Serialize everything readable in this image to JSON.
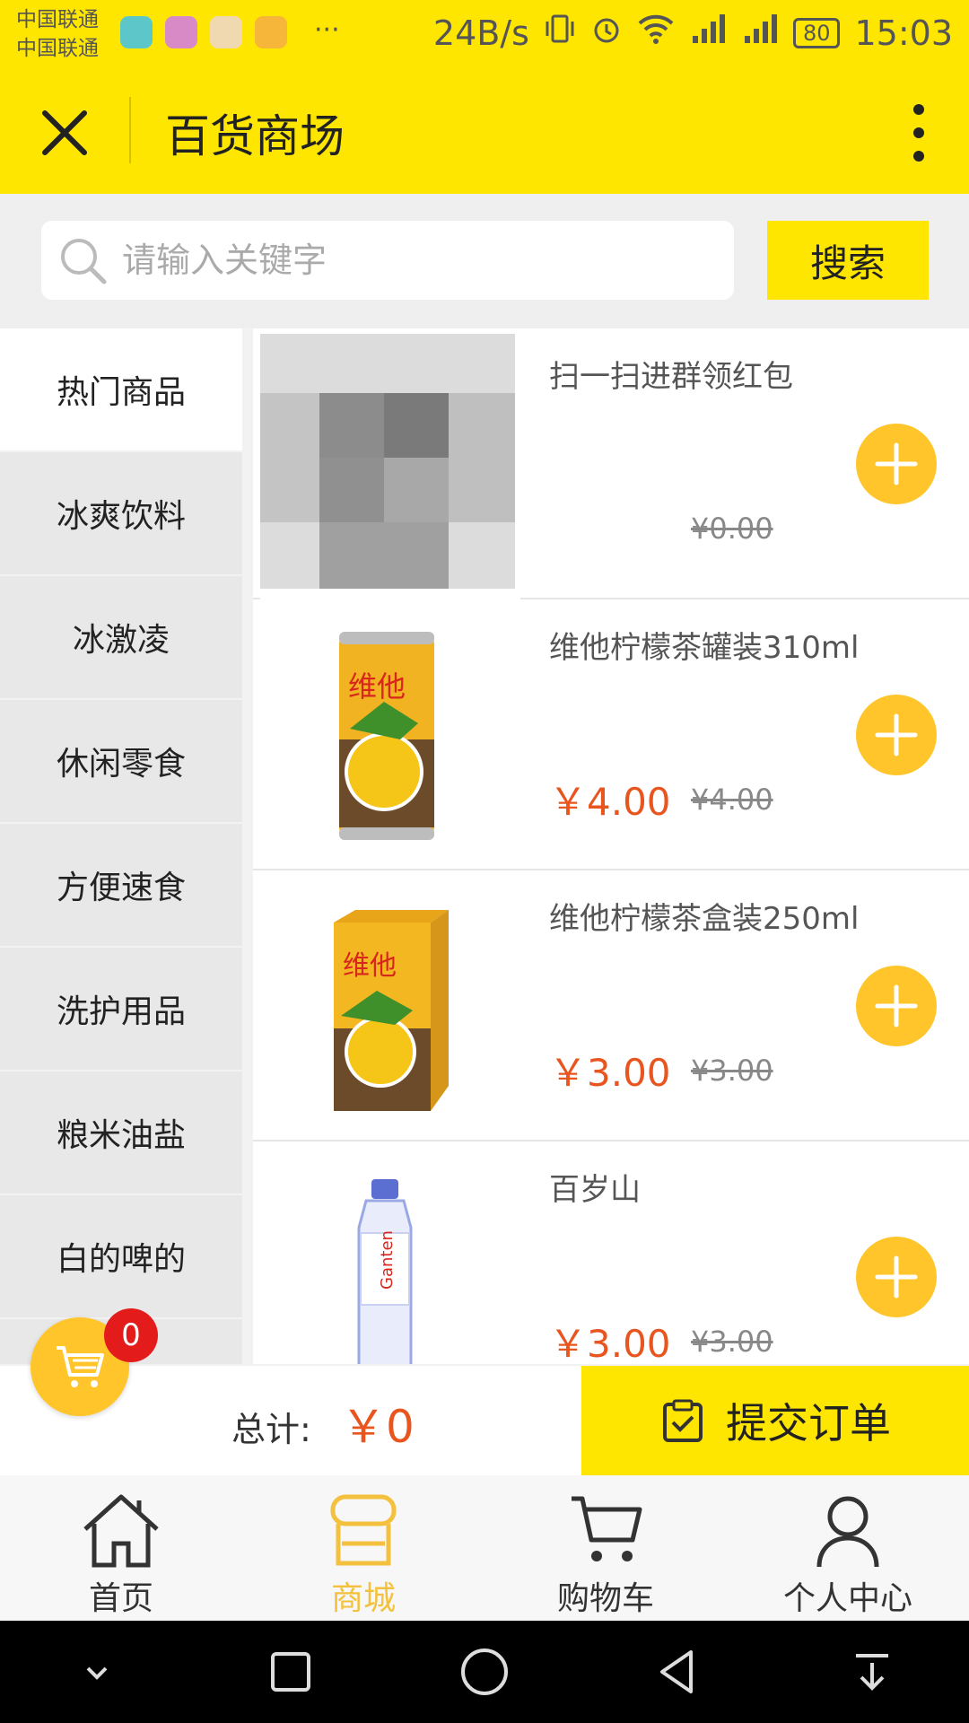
{
  "status_bar": {
    "carrier_1": "中国联通",
    "carrier_2": "中国联通",
    "more": "···",
    "speed": "24B/s",
    "battery": "80",
    "time": "15:03"
  },
  "header": {
    "title": "百货商场"
  },
  "search": {
    "placeholder": "请输入关键字",
    "button_label": "搜索"
  },
  "categories": [
    {
      "label": "热门商品",
      "active": true
    },
    {
      "label": "冰爽饮料"
    },
    {
      "label": "冰激凌"
    },
    {
      "label": "休闲零食"
    },
    {
      "label": "方便速食"
    },
    {
      "label": "洗护用品"
    },
    {
      "label": "粮米油盐"
    },
    {
      "label": "白的啤的"
    }
  ],
  "products": [
    {
      "name": "扫一扫进群领红包",
      "price": "",
      "old_price": "¥0.00"
    },
    {
      "name": "维他柠檬茶罐装310ml",
      "price": "￥4.00",
      "old_price": "¥4.00"
    },
    {
      "name": "维他柠檬茶盒装250ml",
      "price": "￥3.00",
      "old_price": "¥3.00"
    },
    {
      "name": "百岁山",
      "price": "￥3.00",
      "old_price": "¥3.00"
    }
  ],
  "cart": {
    "count": "0"
  },
  "checkout": {
    "total_label": "总计:",
    "total_value": "￥0",
    "submit_label": "提交订单"
  },
  "tabs": [
    {
      "label": "首页"
    },
    {
      "label": "商城",
      "active": true
    },
    {
      "label": "购物车"
    },
    {
      "label": "个人中心"
    }
  ],
  "colors": {
    "brand_yellow": "#ffe600",
    "accent_orange": "#ffc52b",
    "price_red": "#e8551e",
    "badge_red": "#e31b1b"
  }
}
